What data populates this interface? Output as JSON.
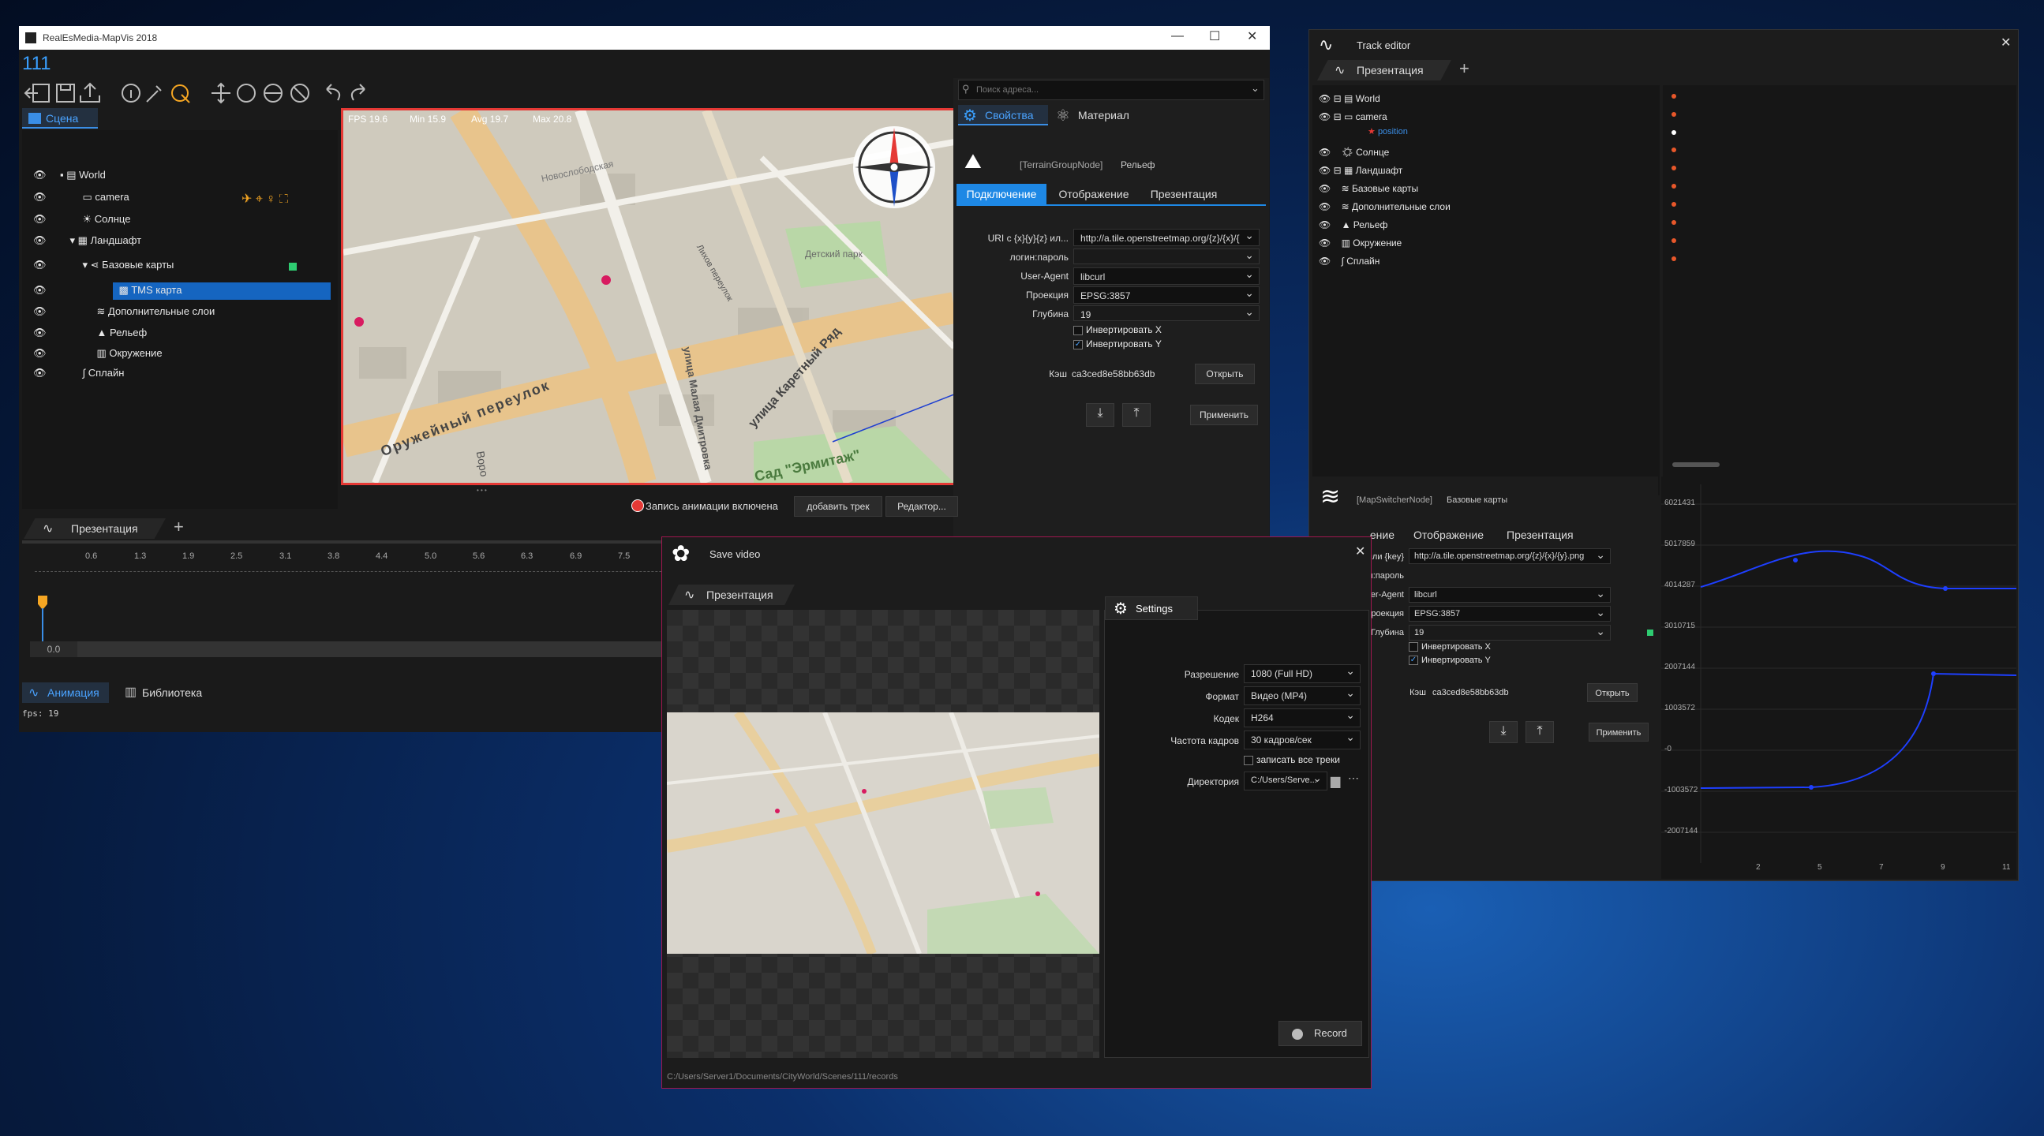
{
  "main": {
    "title": "RealEsMedia-MapVis 2018",
    "project": "111",
    "scene_tab": "Сцена",
    "tree": [
      {
        "label": "World"
      },
      {
        "label": "camera"
      },
      {
        "label": "Солнце"
      },
      {
        "label": "Ландшафт"
      },
      {
        "label": "Базовые карты"
      },
      {
        "label": "TMS карта"
      },
      {
        "label": "Дополнительные слои"
      },
      {
        "label": "Рельеф"
      },
      {
        "label": "Окружение"
      },
      {
        "label": "Сплайн"
      }
    ],
    "viewport": {
      "fps": "FPS 19.6",
      "min": "Min 15.9",
      "avg": "Avg 19.7",
      "max": "Max 20.8",
      "streets": [
        "Оружейный переулок",
        "улица Каретный Ряд",
        "Сад \"Эрмитаж\"",
        "Лихов переулок",
        "Новослободская",
        "Детский парк",
        "улица Малая Дмитровка",
        "Воро"
      ]
    },
    "search_placeholder": "Поиск адреса...",
    "props_tabs": [
      "Свойства",
      "Материал"
    ],
    "node": {
      "type": "[TerrainGroupNode]",
      "name": "Рельеф"
    },
    "subtabs": [
      "Подключение",
      "Отображение",
      "Презентация"
    ],
    "form": {
      "uri_label": "URI с {x}{y}{z} ил...",
      "uri": "http://a.tile.openstreetmap.org/{z}/{x}/{",
      "login_label": "логин:пароль",
      "ua_label": "User-Agent",
      "ua": "libcurl",
      "proj_label": "Проекция",
      "proj": "EPSG:3857",
      "depth_label": "Глубина",
      "depth": "19",
      "invx": "Инвертировать X",
      "invy": "Инвертировать Y",
      "cache_label": "Кэш",
      "cache": "ca3ced8e58bb63db",
      "open": "Открыть",
      "apply": "Применить"
    },
    "rec_status": "Запись анимации включена",
    "add_track": "добавить трек",
    "editor": "Редактор...",
    "pres_tab": "Презентация",
    "ticks": [
      "0.6",
      "1.3",
      "1.9",
      "2.5",
      "3.1",
      "3.8",
      "4.4",
      "5.0",
      "5.6",
      "6.3",
      "6.9",
      "7.5"
    ],
    "time_value": "0.0",
    "bottom_tabs": [
      "Анимация",
      "Библиотека"
    ],
    "fps_text": "fps: 19"
  },
  "track": {
    "title": "Track editor",
    "pres_tab": "Презентация",
    "tree": [
      {
        "label": "World"
      },
      {
        "label": "camera"
      },
      {
        "label": "position"
      },
      {
        "label": "Солнце"
      },
      {
        "label": "Ландшафт"
      },
      {
        "label": "Базовые карты"
      },
      {
        "label": "Дополнительные слои"
      },
      {
        "label": "Рельеф"
      },
      {
        "label": "Окружение"
      },
      {
        "label": "Сплайн"
      }
    ],
    "node": {
      "type": "[MapSwitcherNode]",
      "name": "Базовые карты"
    },
    "subtabs": [
      "ение",
      "Отображение",
      "Презентация"
    ],
    "form": {
      "uri_label": "/{y}/{z} или {key}",
      "uri": "http://a.tile.openstreetmap.org/{z}/{x}/{y}.png",
      "login_label": "логин:пароль",
      "ua_label": "User-Agent",
      "ua": "libcurl",
      "proj_label": "Проекция",
      "proj": "EPSG:3857",
      "depth_label": "Глубина",
      "depth": "19",
      "invx": "Инвертировать X",
      "invy": "Инвертировать Y",
      "cache_label": "Кэш",
      "cache": "ca3ced8e58bb63db",
      "open": "Открыть",
      "apply": "Применить"
    },
    "graph_y": [
      "6021431",
      "5017859",
      "4014287",
      "3010715",
      "2007144",
      "1003572",
      "-0",
      "-1003572",
      "-2007144"
    ],
    "graph_x": [
      "2",
      "5",
      "7",
      "9",
      "11"
    ]
  },
  "save": {
    "title": "Save video",
    "pres_tab": "Презентация",
    "settings_tab": "Settings",
    "resolution_label": "Разрешение",
    "resolution": "1080 (Full HD)",
    "format_label": "Формат",
    "format": "Видео (MP4)",
    "codec_label": "Кодек",
    "codec": "H264",
    "fps_label": "Частота кадров",
    "fps": "30 кадров/сек",
    "all_tracks": "записать все треки",
    "dir_label": "Директория",
    "dir": "C:/Users/Serve...",
    "record": "Record",
    "path": "C:/Users/Server1/Documents/CityWorld/Scenes/111/records"
  }
}
